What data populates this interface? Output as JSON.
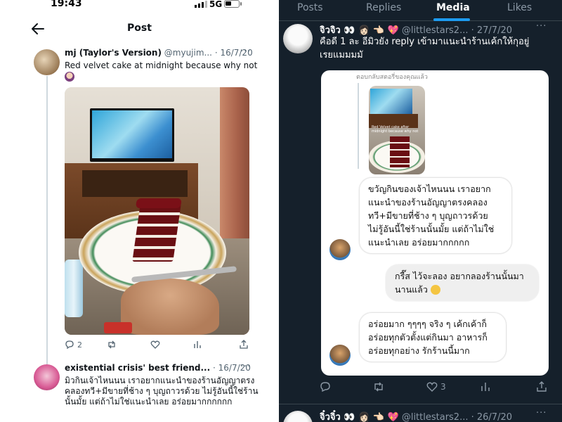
{
  "status_bar": {
    "time": "19:43",
    "network": "5G"
  },
  "left_header": {
    "title": "Post"
  },
  "tweet": {
    "name": "mj (Taylor's Version)",
    "handle": "@myujim...",
    "date": "· 16/7/20",
    "text": "Red velvet cake at midnight because why not",
    "emoji_icon": "woman-tipping-hand-icon",
    "actions": {
      "reply_count": "2",
      "retweet_count": "",
      "like_count": ""
    }
  },
  "reply_tweet": {
    "name": "existential crisis' best friend...",
    "date": "· 16/7/20",
    "text": "มิวกินเจ้าไหนนน เราอยากแนะนำของร้านอัญญาตรงคลองทวี+มีขายที่ช้าง ๆ บุญถาวรด้วย ไม่รู้อันนี้ใช่ร้านนั้นมั้ย แต่ถ้าไม่ใช่แนะนำเลย อร่อยมากกกกกก"
  },
  "right_tabs": [
    {
      "label": "Posts",
      "active": false
    },
    {
      "label": "Replies",
      "active": false
    },
    {
      "label": "Media",
      "active": true
    },
    {
      "label": "Likes",
      "active": false
    }
  ],
  "right_tweet": {
    "name": "จิวจิว 👀 👩🏻 👈🏻 💖",
    "handle": "@littlestars2...",
    "date": "· 27/7/20",
    "text": "คือดี 1 ละ อีมิวยัง reply เข้ามาแนะนำร้านเค้กให้กุอยู่เรยแมมมมั",
    "quote_caption": "ตอบกลับสตอรี่ของคุณแล้ว",
    "thumb_text": "Red Velvet cake after midnight because why not",
    "messages": [
      {
        "from": "other",
        "text": "ขวัญกินของเจ้าไหนนน เราอยากแนะนำของร้านอัญญาตรงคลองทวี+มีขายที่ช้าง ๆ บุญถาวรด้วย ไม่รู้อันนี้ใช่ร้านนั้นมั้ย แต่ถ้าไม่ใช่แนะนำเลย อร่อยมากกกกก"
      },
      {
        "from": "me",
        "text": "กรี๊ส ไว้จะลอง อยากลองร้านนั้นมานานแล้ว"
      },
      {
        "from": "other",
        "text": "อร่อยมาก ๆๆๆๆ จริง ๆ เค้กเค้าก็อร่อยทุกตัวตั้งแต่กินมา อาหารก็อร่อยทุกอย่าง รักร้านนี้มาก"
      }
    ],
    "actions": {
      "like_count": "3"
    }
  },
  "right_next_tweet": {
    "name": "จิ๋วจิ๋ว 👀 👩🏻 👈🏻 💖",
    "handle": "@littlestars2...",
    "date": "· 26/7/20"
  },
  "colors": {
    "accent": "#1d9bf0",
    "dark_bg": "#15202b",
    "light_bg": "#ffffff"
  }
}
